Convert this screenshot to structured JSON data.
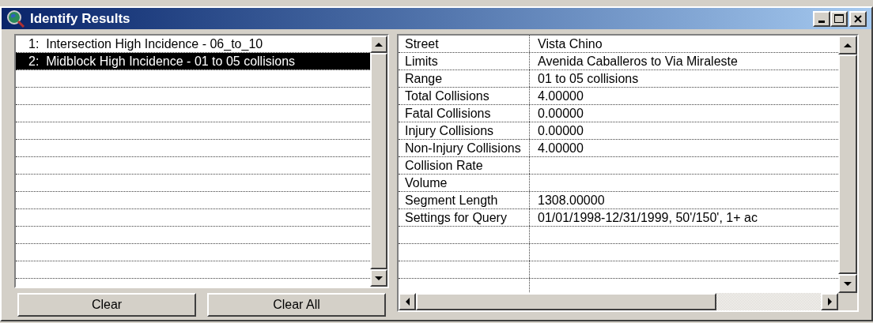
{
  "window": {
    "title": "Identify Results"
  },
  "results": [
    {
      "label": "1:  Intersection High Incidence - 06_to_10",
      "selected": false
    },
    {
      "label": "2:  Midblock High Incidence - 01 to 05 collisions",
      "selected": true
    }
  ],
  "buttons": [
    {
      "label": "Clear"
    },
    {
      "label": "Clear All"
    }
  ],
  "attributes": [
    {
      "field": "Street",
      "value": "Vista Chino"
    },
    {
      "field": "Limits",
      "value": "Avenida Caballeros to Via Miraleste"
    },
    {
      "field": "Range",
      "value": "01 to 05 collisions"
    },
    {
      "field": "Total Collisions",
      "value": "4.00000"
    },
    {
      "field": "Fatal Collisions",
      "value": "0.00000"
    },
    {
      "field": "Injury Collisions",
      "value": "0.00000"
    },
    {
      "field": "Non-Injury Collisions",
      "value": "4.00000"
    },
    {
      "field": "Collision Rate"
    },
    {
      "field": "Volume"
    },
    {
      "field": "Segment Length",
      "value": "1308.00000"
    },
    {
      "field": "Settings for Query",
      "value": "01/01/1998-12/31/1999, 50'/150', 1+ ac"
    }
  ]
}
